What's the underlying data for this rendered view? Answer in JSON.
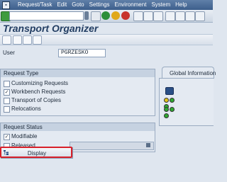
{
  "menubar": {
    "items": [
      "Request/Task",
      "Edit",
      "Goto",
      "Settings",
      "Environment",
      "System",
      "Help"
    ]
  },
  "toolbar": {
    "command_field_value": "",
    "icons": [
      "enter-icon",
      "save-icon",
      "back-icon",
      "exit-icon",
      "cancel-icon",
      "print-icon",
      "find-icon",
      "find-next-icon",
      "first-page-icon",
      "prev-page-icon",
      "next-page-icon",
      "last-page-icon"
    ]
  },
  "title": "Transport Organizer",
  "app_toolbar": {
    "icons": [
      "create-icon",
      "display-object-icon",
      "search-icon",
      "settings-icon"
    ]
  },
  "user": {
    "label": "User",
    "value": "PGRZESKO"
  },
  "request_type": {
    "title": "Request Type",
    "options": [
      {
        "label": "Customizing Requests",
        "checked": false
      },
      {
        "label": "Workbench Requests",
        "checked": true
      },
      {
        "label": "Transport of Copies",
        "checked": false
      },
      {
        "label": "Relocations",
        "checked": false
      }
    ]
  },
  "global_info": {
    "tab_label": "Global Information"
  },
  "request_status": {
    "title": "Request Status",
    "options": [
      {
        "label": "Modifiable",
        "checked": true
      },
      {
        "label": "Released",
        "checked": false
      }
    ]
  },
  "display_button": {
    "label": "Display"
  },
  "colors": {
    "menubar": "#3d5f8c",
    "title": "#233e63",
    "highlight": "#d8202a",
    "led_green": "#2fa832",
    "led_yellow": "#e2c31b",
    "led_red": "#d23a32"
  }
}
